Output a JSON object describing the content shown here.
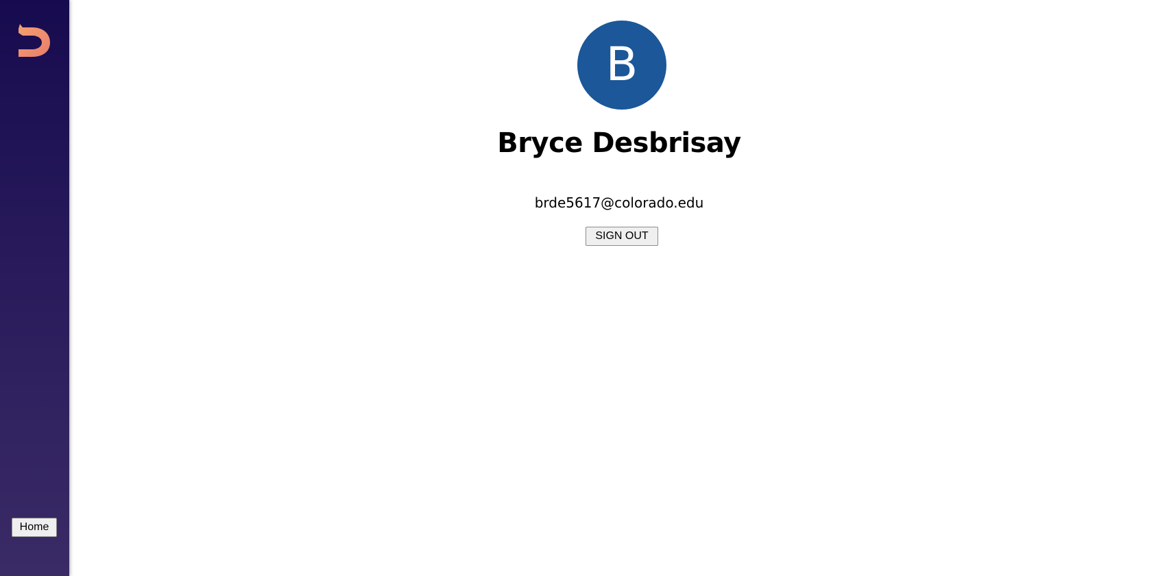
{
  "sidebar": {
    "logo_icon": "d-logo-icon",
    "home_label": "Home"
  },
  "profile": {
    "avatar_initial": "B",
    "name": "Bryce Desbrisay",
    "email": "brde5617@colorado.edu",
    "sign_out_label": "SIGN OUT"
  },
  "colors": {
    "sidebar_top": "#170b4f",
    "sidebar_bottom": "#3a2b66",
    "logo": "#f0906a",
    "avatar_bg": "#1b5799"
  }
}
